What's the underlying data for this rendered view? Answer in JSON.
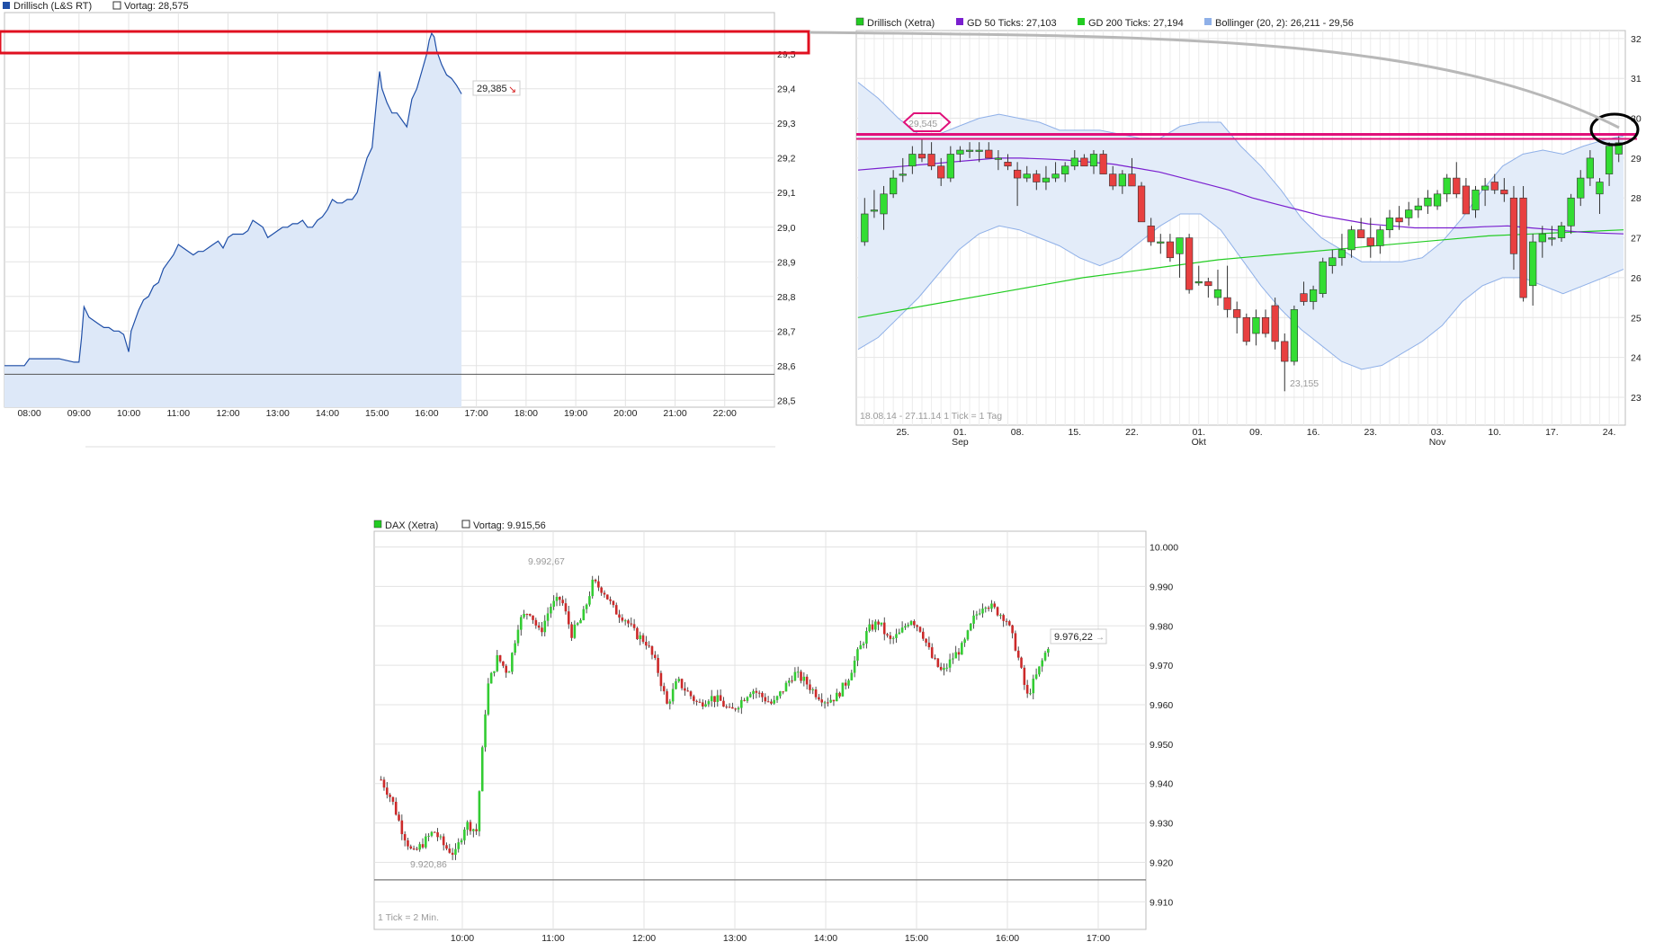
{
  "chart_data": [
    {
      "id": "intraday",
      "type": "area",
      "legend": [
        {
          "label": "Drillisch (L&S RT)",
          "color": "#1f4fa8"
        },
        {
          "label": "Vortag: 28,575",
          "color": "#ffffff"
        }
      ],
      "xticks": [
        "08:00",
        "09:00",
        "10:00",
        "11:00",
        "12:00",
        "13:00",
        "14:00",
        "15:00",
        "16:00",
        "17:00",
        "18:00",
        "19:00",
        "20:00",
        "21:00",
        "22:00"
      ],
      "yticks": [
        "29,5",
        "29,4",
        "29,3",
        "29,2",
        "29,1",
        "29,0",
        "28,9",
        "28,8",
        "28,7",
        "28,6",
        "28,5"
      ],
      "ylim": [
        28.48,
        29.62
      ],
      "xlim": [
        7.5,
        23.0
      ],
      "previous_close": 28.575,
      "last_label": "29,385",
      "series": [
        {
          "x": [
            7.5,
            7.9,
            8.0,
            8.3,
            8.6,
            8.9,
            9.0,
            9.05,
            9.1,
            9.2,
            9.3,
            9.4,
            9.5,
            9.6,
            9.7,
            9.8,
            9.9,
            10.0,
            10.05,
            10.1,
            10.2,
            10.3,
            10.4,
            10.5,
            10.6,
            10.7,
            10.8,
            10.9,
            11.0,
            11.1,
            11.2,
            11.3,
            11.4,
            11.5,
            11.6,
            11.7,
            11.8,
            11.9,
            12.0,
            12.1,
            12.2,
            12.3,
            12.4,
            12.5,
            12.6,
            12.7,
            12.8,
            12.9,
            13.0,
            13.1,
            13.2,
            13.3,
            13.4,
            13.5,
            13.6,
            13.7,
            13.8,
            13.9,
            14.0,
            14.1,
            14.2,
            14.3,
            14.4,
            14.5,
            14.6,
            14.7,
            14.8,
            14.9,
            15.0,
            15.05,
            15.1,
            15.2,
            15.3,
            15.4,
            15.5,
            15.6,
            15.7,
            15.8,
            15.9,
            16.0,
            16.05,
            16.1,
            16.15,
            16.2,
            16.3,
            16.4,
            16.5,
            16.6,
            16.7
          ],
          "values": [
            28.6,
            28.6,
            28.62,
            28.62,
            28.62,
            28.61,
            28.61,
            28.68,
            28.77,
            28.74,
            28.73,
            28.72,
            28.71,
            28.71,
            28.7,
            28.7,
            28.69,
            28.64,
            28.7,
            28.72,
            28.76,
            28.79,
            28.8,
            28.83,
            28.84,
            28.88,
            28.9,
            28.92,
            28.95,
            28.94,
            28.93,
            28.92,
            28.93,
            28.93,
            28.94,
            28.95,
            28.96,
            28.94,
            28.97,
            28.98,
            28.98,
            28.98,
            28.99,
            29.02,
            29.01,
            29.0,
            28.97,
            28.98,
            28.99,
            29.0,
            29.0,
            29.01,
            29.01,
            29.02,
            29.0,
            29.0,
            29.02,
            29.03,
            29.05,
            29.08,
            29.07,
            29.07,
            29.08,
            29.08,
            29.1,
            29.15,
            29.2,
            29.23,
            29.38,
            29.45,
            29.4,
            29.36,
            29.33,
            29.33,
            29.31,
            29.29,
            29.37,
            29.4,
            29.45,
            29.5,
            29.54,
            29.56,
            29.55,
            29.51,
            29.47,
            29.44,
            29.43,
            29.41,
            29.385
          ]
        }
      ]
    },
    {
      "id": "daily",
      "type": "candlestick",
      "legend": [
        {
          "label": "Drillisch (Xetra)",
          "color": "#22cc22"
        },
        {
          "label": "GD 50 Ticks: 27,103",
          "color": "#7a1fcf"
        },
        {
          "label": "GD 200 Ticks: 27,194",
          "color": "#22cc22"
        },
        {
          "label": "Bollinger (20, 2): 26,211 - 29,56",
          "color": "#8fb0e8"
        }
      ],
      "yticks": [
        "32",
        "31",
        "30",
        "29",
        "28",
        "27",
        "26",
        "25",
        "24",
        "23"
      ],
      "ylim": [
        22.3,
        32.2
      ],
      "xticks": [
        "25.",
        "01.",
        "08.",
        "15.",
        "22.",
        "01.",
        "09.",
        "16.",
        "23.",
        "03.",
        "10.",
        "17.",
        "24."
      ],
      "month_labels": [
        "Sep",
        "Okt",
        "Nov"
      ],
      "range_note": "18.08.14 - 27.11.14   1 Tick = 1 Tag",
      "annotations": {
        "high_label": "29,545",
        "low_label": "23,155",
        "resistance": 29.55
      },
      "candles": [
        {
          "o": 26.9,
          "h": 28.0,
          "l": 26.8,
          "c": 27.6
        },
        {
          "o": 27.7,
          "h": 28.2,
          "l": 27.5,
          "c": 27.7
        },
        {
          "o": 27.6,
          "h": 28.3,
          "l": 27.2,
          "c": 28.1
        },
        {
          "o": 28.1,
          "h": 28.7,
          "l": 28.0,
          "c": 28.5
        },
        {
          "o": 28.6,
          "h": 29.0,
          "l": 28.4,
          "c": 28.6
        },
        {
          "o": 28.8,
          "h": 29.3,
          "l": 28.6,
          "c": 29.1
        },
        {
          "o": 29.1,
          "h": 29.5,
          "l": 28.9,
          "c": 29.0
        },
        {
          "o": 29.1,
          "h": 29.4,
          "l": 28.7,
          "c": 28.8
        },
        {
          "o": 28.8,
          "h": 29.0,
          "l": 28.3,
          "c": 28.5
        },
        {
          "o": 28.5,
          "h": 29.3,
          "l": 28.4,
          "c": 29.1
        },
        {
          "o": 29.1,
          "h": 29.3,
          "l": 28.9,
          "c": 29.2
        },
        {
          "o": 29.2,
          "h": 29.4,
          "l": 29.0,
          "c": 29.2
        },
        {
          "o": 29.2,
          "h": 29.4,
          "l": 28.9,
          "c": 29.2
        },
        {
          "o": 29.2,
          "h": 29.4,
          "l": 29.0,
          "c": 29.0
        },
        {
          "o": 29.0,
          "h": 29.2,
          "l": 28.7,
          "c": 29.0
        },
        {
          "o": 28.9,
          "h": 29.1,
          "l": 28.7,
          "c": 28.8
        },
        {
          "o": 28.7,
          "h": 28.9,
          "l": 27.8,
          "c": 28.5
        },
        {
          "o": 28.5,
          "h": 28.8,
          "l": 28.4,
          "c": 28.6
        },
        {
          "o": 28.6,
          "h": 28.7,
          "l": 28.2,
          "c": 28.4
        },
        {
          "o": 28.4,
          "h": 28.8,
          "l": 28.2,
          "c": 28.5
        },
        {
          "o": 28.5,
          "h": 28.9,
          "l": 28.4,
          "c": 28.6
        },
        {
          "o": 28.6,
          "h": 28.9,
          "l": 28.4,
          "c": 28.8
        },
        {
          "o": 28.8,
          "h": 29.2,
          "l": 28.7,
          "c": 29.0
        },
        {
          "o": 29.0,
          "h": 29.1,
          "l": 28.8,
          "c": 28.8
        },
        {
          "o": 28.8,
          "h": 29.2,
          "l": 28.6,
          "c": 29.1
        },
        {
          "o": 29.1,
          "h": 29.2,
          "l": 28.6,
          "c": 28.6
        },
        {
          "o": 28.6,
          "h": 28.8,
          "l": 28.2,
          "c": 28.3
        },
        {
          "o": 28.3,
          "h": 28.7,
          "l": 28.1,
          "c": 28.6
        },
        {
          "o": 28.6,
          "h": 29.0,
          "l": 28.3,
          "c": 28.3
        },
        {
          "o": 28.3,
          "h": 28.4,
          "l": 27.4,
          "c": 27.4
        },
        {
          "o": 27.3,
          "h": 27.5,
          "l": 26.8,
          "c": 26.9
        },
        {
          "o": 26.9,
          "h": 27.1,
          "l": 26.6,
          "c": 26.9
        },
        {
          "o": 26.9,
          "h": 27.1,
          "l": 26.4,
          "c": 26.5
        },
        {
          "o": 26.6,
          "h": 27.0,
          "l": 26.0,
          "c": 27.0
        },
        {
          "o": 27.0,
          "h": 27.1,
          "l": 25.6,
          "c": 25.7
        },
        {
          "o": 25.9,
          "h": 26.3,
          "l": 25.8,
          "c": 25.9
        },
        {
          "o": 25.9,
          "h": 26.0,
          "l": 25.5,
          "c": 25.8
        },
        {
          "o": 25.5,
          "h": 26.2,
          "l": 25.3,
          "c": 25.7
        },
        {
          "o": 25.5,
          "h": 26.3,
          "l": 25.0,
          "c": 25.2
        },
        {
          "o": 25.2,
          "h": 25.4,
          "l": 24.6,
          "c": 25.0
        },
        {
          "o": 25.0,
          "h": 25.1,
          "l": 24.3,
          "c": 24.4
        },
        {
          "o": 24.6,
          "h": 25.2,
          "l": 24.3,
          "c": 25.0
        },
        {
          "o": 25.0,
          "h": 25.2,
          "l": 24.5,
          "c": 24.6
        },
        {
          "o": 25.3,
          "h": 25.5,
          "l": 24.2,
          "c": 24.4
        },
        {
          "o": 24.4,
          "h": 24.6,
          "l": 23.15,
          "c": 23.9
        },
        {
          "o": 23.9,
          "h": 25.3,
          "l": 23.8,
          "c": 25.2
        },
        {
          "o": 25.6,
          "h": 25.9,
          "l": 25.3,
          "c": 25.4
        },
        {
          "o": 25.4,
          "h": 25.8,
          "l": 25.2,
          "c": 25.7
        },
        {
          "o": 25.6,
          "h": 26.5,
          "l": 25.5,
          "c": 26.4
        },
        {
          "o": 26.3,
          "h": 26.7,
          "l": 26.1,
          "c": 26.5
        },
        {
          "o": 26.5,
          "h": 27.1,
          "l": 26.3,
          "c": 26.7
        },
        {
          "o": 26.7,
          "h": 27.3,
          "l": 26.5,
          "c": 27.2
        },
        {
          "o": 27.2,
          "h": 27.5,
          "l": 27.0,
          "c": 27.0
        },
        {
          "o": 27.0,
          "h": 27.5,
          "l": 26.5,
          "c": 26.8
        },
        {
          "o": 26.8,
          "h": 27.3,
          "l": 26.6,
          "c": 27.2
        },
        {
          "o": 27.2,
          "h": 27.7,
          "l": 27.0,
          "c": 27.5
        },
        {
          "o": 27.5,
          "h": 27.8,
          "l": 27.2,
          "c": 27.4
        },
        {
          "o": 27.5,
          "h": 27.9,
          "l": 27.3,
          "c": 27.7
        },
        {
          "o": 27.7,
          "h": 28.0,
          "l": 27.5,
          "c": 27.8
        },
        {
          "o": 27.8,
          "h": 28.2,
          "l": 27.6,
          "c": 28.0
        },
        {
          "o": 27.8,
          "h": 28.2,
          "l": 27.7,
          "c": 28.1
        },
        {
          "o": 28.1,
          "h": 28.6,
          "l": 27.9,
          "c": 28.5
        },
        {
          "o": 28.5,
          "h": 28.9,
          "l": 28.0,
          "c": 28.1
        },
        {
          "o": 28.3,
          "h": 28.5,
          "l": 27.6,
          "c": 27.6
        },
        {
          "o": 27.7,
          "h": 28.3,
          "l": 27.5,
          "c": 28.2
        },
        {
          "o": 28.2,
          "h": 28.5,
          "l": 27.8,
          "c": 28.3
        },
        {
          "o": 28.4,
          "h": 28.6,
          "l": 28.1,
          "c": 28.2
        },
        {
          "o": 28.2,
          "h": 28.5,
          "l": 27.9,
          "c": 28.1
        },
        {
          "o": 28.0,
          "h": 28.3,
          "l": 26.2,
          "c": 26.6
        },
        {
          "o": 28.0,
          "h": 28.3,
          "l": 25.4,
          "c": 25.5
        },
        {
          "o": 25.8,
          "h": 27.1,
          "l": 25.3,
          "c": 26.9
        },
        {
          "o": 26.9,
          "h": 27.3,
          "l": 26.5,
          "c": 27.1
        },
        {
          "o": 27.0,
          "h": 27.3,
          "l": 26.8,
          "c": 27.0
        },
        {
          "o": 27.0,
          "h": 27.4,
          "l": 26.9,
          "c": 27.3
        },
        {
          "o": 27.3,
          "h": 28.1,
          "l": 27.1,
          "c": 28.0
        },
        {
          "o": 28.0,
          "h": 28.7,
          "l": 27.8,
          "c": 28.5
        },
        {
          "o": 28.5,
          "h": 29.2,
          "l": 28.3,
          "c": 29.0
        },
        {
          "o": 28.1,
          "h": 28.5,
          "l": 27.6,
          "c": 28.4
        },
        {
          "o": 28.6,
          "h": 29.4,
          "l": 28.3,
          "c": 29.3
        },
        {
          "o": 29.1,
          "h": 29.55,
          "l": 28.9,
          "c": 29.385
        }
      ],
      "gd50": [
        28.7,
        28.75,
        28.8,
        28.85,
        28.9,
        28.95,
        29.0,
        29.0,
        28.98,
        28.95,
        28.9,
        28.85,
        28.75,
        28.65,
        28.5,
        28.35,
        28.2,
        28.0,
        27.85,
        27.7,
        27.55,
        27.45,
        27.35,
        27.3,
        27.25,
        27.25,
        27.25,
        27.28,
        27.3,
        27.25,
        27.2,
        27.15,
        27.12,
        27.1
      ],
      "gd200": [
        25.0,
        25.2,
        25.4,
        25.6,
        25.8,
        26.0,
        26.15,
        26.3,
        26.45,
        26.55,
        26.65,
        26.75,
        26.85,
        26.95,
        27.05,
        27.1,
        27.15,
        27.2
      ],
      "boll_upper": [
        30.9,
        30.5,
        30.0,
        29.6,
        29.6,
        29.8,
        30.0,
        30.1,
        30.0,
        29.9,
        29.7,
        29.7,
        29.7,
        29.6,
        29.5,
        29.5,
        29.8,
        29.9,
        29.9,
        29.3,
        28.8,
        28.2,
        27.5,
        27.0,
        26.7,
        26.4,
        26.4,
        26.4,
        26.5,
        26.9,
        27.5,
        28.2,
        28.8,
        29.1,
        29.2,
        29.1,
        29.3,
        29.45,
        29.56
      ],
      "boll_lower": [
        24.2,
        24.5,
        25.0,
        25.5,
        26.1,
        26.7,
        27.1,
        27.3,
        27.2,
        27.0,
        26.8,
        26.5,
        26.3,
        26.5,
        26.9,
        27.3,
        27.6,
        27.6,
        27.2,
        26.5,
        25.8,
        25.2,
        24.7,
        24.3,
        23.9,
        23.7,
        23.8,
        24.1,
        24.4,
        24.8,
        25.4,
        25.8,
        26.0,
        26.0,
        25.8,
        25.6,
        25.8,
        26.0,
        26.211
      ]
    },
    {
      "id": "dax",
      "type": "candlestick",
      "legend": [
        {
          "label": "DAX (Xetra)",
          "color": "#22cc22"
        },
        {
          "label": "Vortag: 9.915,56",
          "color": "#ffffff"
        }
      ],
      "yticks": [
        "10.000",
        "9.990",
        "9.980",
        "9.970",
        "9.960",
        "9.950",
        "9.940",
        "9.930",
        "9.920",
        "9.910"
      ],
      "ylim": [
        9903.0,
        10004.0
      ],
      "xticks": [
        "10:00",
        "11:00",
        "12:00",
        "13:00",
        "14:00",
        "15:00",
        "16:00",
        "17:00"
      ],
      "previous_close": 9915.56,
      "range_note": "1 Tick = 2 Min.",
      "annotations": {
        "high_label": "9.992,67",
        "low_label": "9.920,86",
        "last_label": "9.976,22"
      },
      "path": [
        [
          0,
          9941
        ],
        [
          1,
          9936
        ],
        [
          2,
          9928
        ],
        [
          3,
          9922
        ],
        [
          4,
          9925
        ],
        [
          5,
          9928
        ],
        [
          6,
          9924
        ],
        [
          7,
          9922
        ],
        [
          8,
          9930
        ],
        [
          9,
          9928
        ],
        [
          10,
          9964
        ],
        [
          11,
          9972
        ],
        [
          12,
          9968
        ],
        [
          13,
          9981
        ],
        [
          14,
          9984
        ],
        [
          15,
          9978
        ],
        [
          16,
          9985
        ],
        [
          17,
          9987
        ],
        [
          18,
          9978
        ],
        [
          19,
          9982
        ],
        [
          20,
          9991
        ],
        [
          21,
          9989
        ],
        [
          22,
          9984
        ],
        [
          23,
          9982
        ],
        [
          24,
          9978
        ],
        [
          25,
          9976
        ],
        [
          26,
          9970
        ],
        [
          27,
          9960
        ],
        [
          28,
          9966
        ],
        [
          29,
          9963
        ],
        [
          30,
          9960
        ],
        [
          31,
          9962
        ],
        [
          32,
          9961
        ],
        [
          33,
          9958
        ],
        [
          34,
          9961
        ],
        [
          35,
          9964
        ],
        [
          36,
          9962
        ],
        [
          37,
          9960
        ],
        [
          38,
          9964
        ],
        [
          39,
          9968
        ],
        [
          40,
          9966
        ],
        [
          41,
          9963
        ],
        [
          42,
          9961
        ],
        [
          43,
          9962
        ],
        [
          44,
          9966
        ],
        [
          45,
          9973
        ],
        [
          46,
          9979
        ],
        [
          47,
          9981
        ],
        [
          48,
          9976
        ],
        [
          49,
          9978
        ],
        [
          50,
          9982
        ],
        [
          51,
          9979
        ],
        [
          52,
          9972
        ],
        [
          53,
          9968
        ],
        [
          54,
          9972
        ],
        [
          55,
          9975
        ],
        [
          56,
          9982
        ],
        [
          57,
          9986
        ],
        [
          58,
          9984
        ],
        [
          59,
          9982
        ],
        [
          60,
          9974
        ],
        [
          61,
          9962
        ],
        [
          62,
          9968
        ],
        [
          63,
          9975
        ]
      ]
    }
  ],
  "panel_axis_labels": {
    "left_footer_a": " ",
    "dax_footer": "1 Tick = 2 Min."
  }
}
